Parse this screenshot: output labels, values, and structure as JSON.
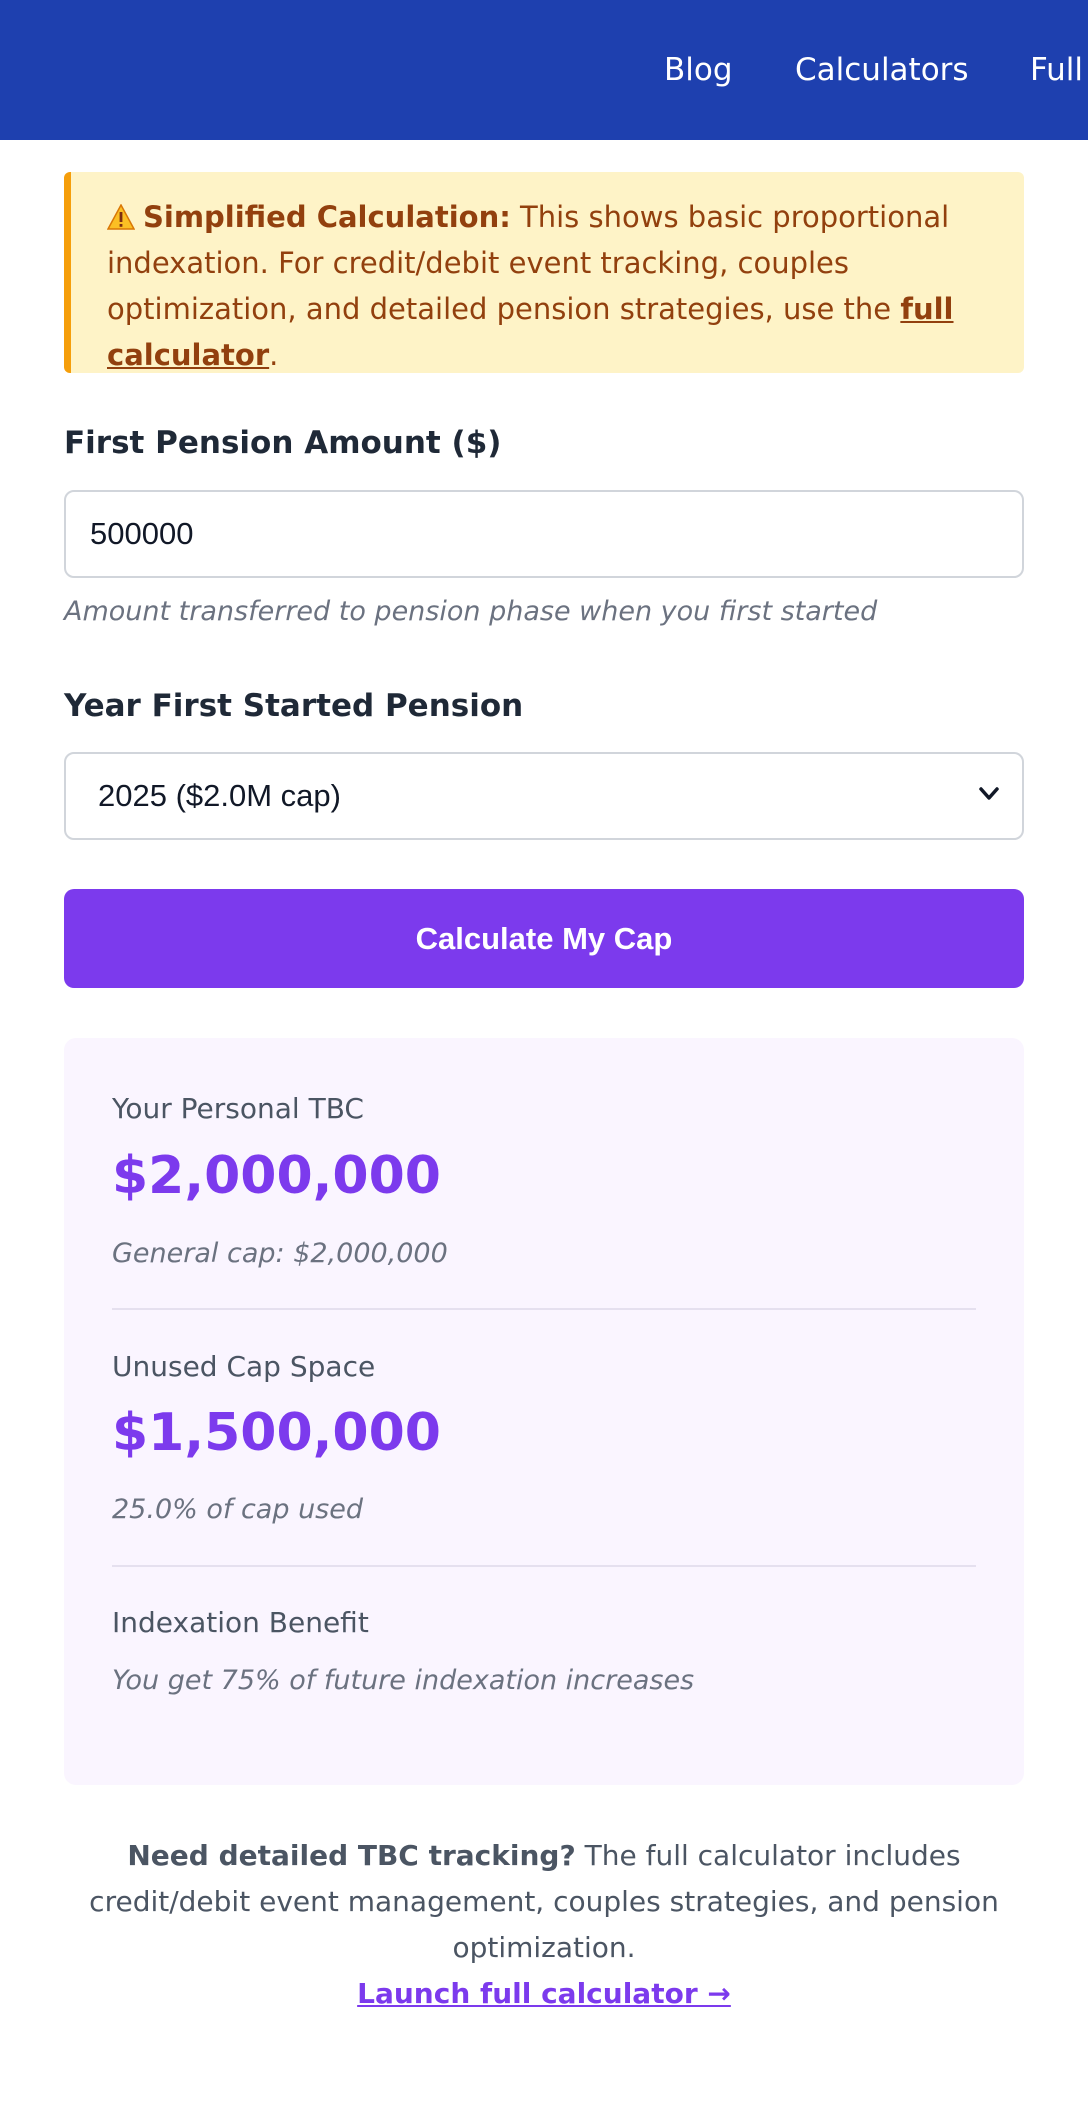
{
  "nav": {
    "items": [
      "Blog",
      "Calculators",
      "Full"
    ]
  },
  "alert": {
    "title": "Simplified Calculation:",
    "text_before_link": " This shows basic proportional indexation. For credit/debit event tracking, couples optimization, and detailed pension strategies, use the ",
    "link_text": "full calculator",
    "text_after_link": "."
  },
  "form": {
    "pension_amount_label": "First Pension Amount ($)",
    "pension_amount_value": "500000",
    "pension_amount_hint": "Amount transferred to pension phase when you first started",
    "year_label": "Year First Started Pension",
    "year_selected": "2025 ($2.0M cap)",
    "calculate_label": "Calculate My Cap"
  },
  "results": {
    "personal_tbc_label": "Your Personal TBC",
    "personal_tbc_value": "$2,000,000",
    "general_cap_note": "General cap: $2,000,000",
    "unused_label": "Unused Cap Space",
    "unused_value": "$1,500,000",
    "cap_used_note": "25.0% of cap used",
    "indexation_label": "Indexation Benefit",
    "indexation_note": "You get 75% of future indexation increases"
  },
  "footer": {
    "bold_text": "Need detailed TBC tracking?",
    "text": " The full calculator includes credit/debit event management, couples strategies, and pension optimization.",
    "link_text": "Launch full calculator →"
  },
  "colors": {
    "header_bg": "#1e40af",
    "accent": "#7c3aed",
    "alert_bg": "#fef3c7",
    "alert_border": "#f59e0b",
    "alert_text": "#92400e",
    "results_bg": "#faf5ff"
  }
}
